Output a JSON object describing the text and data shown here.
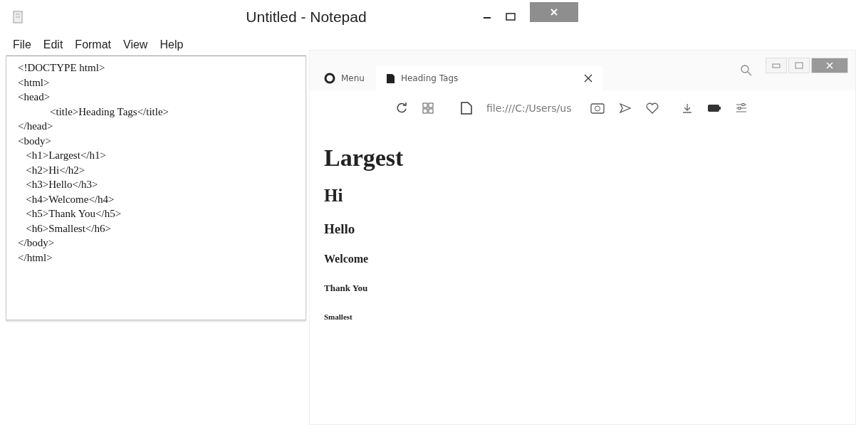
{
  "notepad": {
    "title": "Untitled - Notepad",
    "menu": [
      "File",
      "Edit",
      "Format",
      "View",
      "Help"
    ],
    "text": "<!DOCTYPE html>\n<html>\n<head>\n            <title>Heading Tags</title>\n</head>\n<body>\n   <h1>Largest</h1>\n   <h2>Hi</h2>\n   <h3>Hello</h3>\n   <h4>Welcome</h4>\n   <h5>Thank You</h5>\n   <h6>Smallest</h6>\n</body>\n</html>"
  },
  "browser": {
    "menu_label": "Menu",
    "tabs": [
      {
        "label": "Heading Tags",
        "selected": true
      }
    ],
    "address": "file:///C:/Users/us",
    "headings": [
      {
        "kind": "h1",
        "text": "Largest"
      },
      {
        "kind": "h2",
        "text": "Hi"
      },
      {
        "kind": "h3",
        "text": "Hello"
      },
      {
        "kind": "h4",
        "text": "Welcome"
      },
      {
        "kind": "h5",
        "text": "Thank You"
      },
      {
        "kind": "h6",
        "text": "Smallest"
      }
    ]
  }
}
